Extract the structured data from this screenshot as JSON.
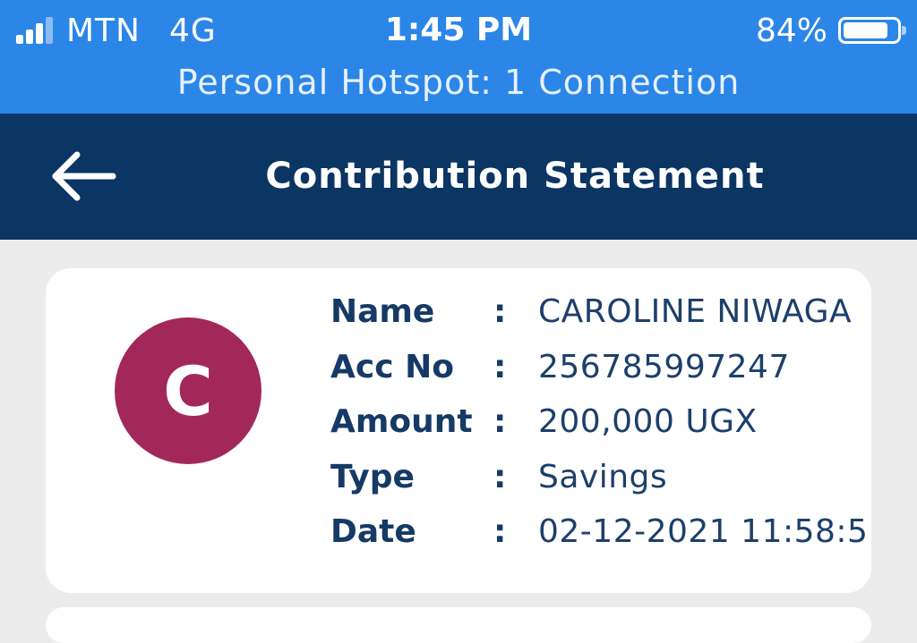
{
  "status_bar": {
    "carrier": "MTN",
    "network": "4G",
    "time": "1:45 PM",
    "battery_percent": "84%",
    "battery_level": 0.84,
    "signal_bars_filled": 3,
    "signal_bars_total": 4,
    "hotspot_text": "Personal Hotspot: 1 Connection",
    "icons": [
      "signal-icon",
      "battery-icon"
    ]
  },
  "header": {
    "title": "Contribution Statement",
    "back_icon": "arrow-left-icon"
  },
  "statement": {
    "avatar_initial": "C",
    "avatar_color": "#a3285a",
    "rows": [
      {
        "label": "Name",
        "sep": ":",
        "value": "CAROLINE NIWAGA"
      },
      {
        "label": "Acc No",
        "sep": ":",
        "value": "256785997247"
      },
      {
        "label": "Amount",
        "sep": ":",
        "value": "200,000 UGX"
      },
      {
        "label": "Type",
        "sep": ":",
        "value": "Savings"
      },
      {
        "label": "Date",
        "sep": ":",
        "value": "02-12-2021 11:58:5"
      }
    ]
  },
  "colors": {
    "status_bar": "#2b86e8",
    "header": "#0b3563",
    "background": "#ececec",
    "label_text": "#163a66"
  }
}
